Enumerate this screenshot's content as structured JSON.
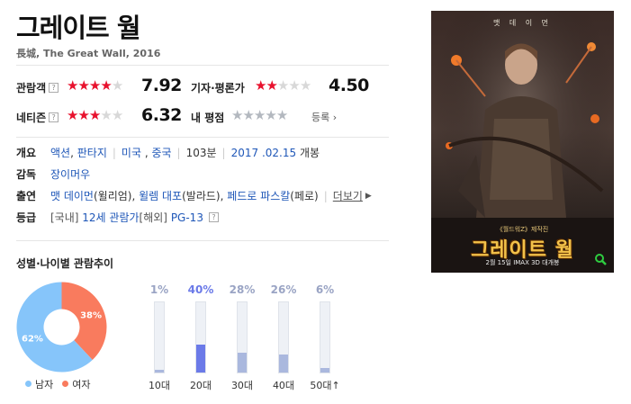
{
  "movie": {
    "title": "그레이트 월",
    "subtitle": "長城, The Great Wall, 2016"
  },
  "ratings": {
    "audience": {
      "label": "관람객",
      "score": "7.92",
      "stars_filled": 4
    },
    "critic": {
      "label": "기자·평론가",
      "score": "4.50",
      "stars_filled": 2
    },
    "netizen": {
      "label": "네티즌",
      "score": "6.32",
      "stars_filled": 3
    },
    "mine": {
      "label": "내 평점",
      "stars_filled": 0
    },
    "register_label": "등록",
    "help_glyph": "?",
    "star_glyph": "★",
    "colors": {
      "filled": "#e8112d",
      "empty": "#d8d8d8",
      "mine": "#b3b8bf"
    }
  },
  "info": {
    "overview": {
      "label": "개요",
      "genres": [
        "액션",
        "판타지"
      ],
      "countries": [
        "미국",
        "중국"
      ],
      "runtime": "103분",
      "release_date": "2017 .02.15",
      "release_suffix": "개봉"
    },
    "director": {
      "label": "감독",
      "name": "장이머우"
    },
    "cast": {
      "label": "출연",
      "actors": [
        {
          "name": "맷 데이먼",
          "role": "(윌리엄)"
        },
        {
          "name": "윌렘 대포",
          "role": "(발라드)"
        },
        {
          "name": "페드로 파스칼",
          "role": "(페로)"
        }
      ],
      "more_label": "더보기"
    },
    "grade": {
      "label": "등급",
      "domestic_prefix": "[국내]",
      "domestic": "12세 관람가",
      "overseas_prefix": "[해외]",
      "overseas": "PG-13"
    }
  },
  "audience_trend": {
    "title": "성별·나이별 관람추이",
    "gender": [
      {
        "name": "남자",
        "percent_label": "62%",
        "value": 62,
        "color": "#86c5fa"
      },
      {
        "name": "여자",
        "percent_label": "38%",
        "value": 38,
        "color": "#f97b5e"
      }
    ],
    "age": [
      {
        "label": "10대",
        "percent_label": "1%",
        "value": 1,
        "highlight": false
      },
      {
        "label": "20대",
        "percent_label": "40%",
        "value": 40,
        "highlight": true
      },
      {
        "label": "30대",
        "percent_label": "28%",
        "value": 28,
        "highlight": false
      },
      {
        "label": "40대",
        "percent_label": "26%",
        "value": 26,
        "highlight": false
      },
      {
        "label": "50대↑",
        "percent_label": "6%",
        "value": 6,
        "highlight": false
      }
    ]
  },
  "poster": {
    "top_text": "맷 데 이 먼",
    "pre_title": "《월드워Z》제작진",
    "title": "그레이트 월",
    "date_text": "2월 15일 IMAX 3D 대개봉"
  },
  "chart_data": [
    {
      "type": "pie",
      "title": "",
      "categories": [
        "남자",
        "여자"
      ],
      "values": [
        62,
        38
      ]
    },
    {
      "type": "bar",
      "title": "",
      "categories": [
        "10대",
        "20대",
        "30대",
        "40대",
        "50대↑"
      ],
      "values": [
        1,
        40,
        28,
        26,
        6
      ],
      "ylim": [
        0,
        100
      ]
    }
  ]
}
